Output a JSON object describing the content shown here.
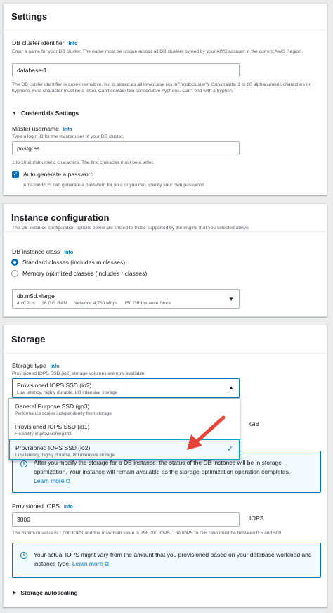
{
  "settings": {
    "title": "Settings",
    "cluster_identifier": {
      "label": "DB cluster identifier",
      "info": "Info",
      "description": "Enter a name for your DB cluster. The name must be unique across all DB clusters owned by your AWS account in the current AWS Region.",
      "value": "database-1",
      "constraints": "The DB cluster identifier is case-insensitive, but is stored as all lowercase (as in \"mydbcluster\"). Constraints: 1 to 60 alphanumeric characters or hyphens. First character must be a letter. Can't contain two consecutive hyphens. Can't end with a hyphen."
    },
    "credentials": {
      "title": "Credentials Settings",
      "master_username_label": "Master username",
      "info": "Info",
      "master_username_desc": "Type a login ID for the master user of your DB cluster.",
      "master_username_value": "postgres",
      "master_username_constraints": "1 to 16 alphanumeric characters. The first character must be a letter.",
      "auto_password_label": "Auto generate a password",
      "auto_password_checked": true,
      "auto_password_desc": "Amazon RDS can generate a password for you, or you can specify your own password."
    }
  },
  "instance_config": {
    "title": "Instance configuration",
    "description": "The DB instance configuration options below are limited to those supported by the engine that you selected above.",
    "class_label": "DB instance class",
    "info": "Info",
    "options": [
      {
        "label": "Standard classes (includes m classes)",
        "selected": true
      },
      {
        "label": "Memory optimized classes (includes r classes)",
        "selected": false
      }
    ],
    "selected_class": "db.m5d.xlarge",
    "selected_class_details": "4 vCPUs     16 GiB RAM     Network: 4,750 Mbps     150 GB Instance Store"
  },
  "storage": {
    "title": "Storage",
    "type_label": "Storage type",
    "info": "Info",
    "type_desc": "Provisioned IOPS SSD (io2) storage volumes are now available.",
    "selected_type": "Provisioned IOPS SSD (io2)",
    "selected_type_desc": "Low latency, highly durable, I/O intensive storage",
    "dropdown_options": [
      {
        "title": "General Purpose SSD (gp3)",
        "desc": "Performance scales independently from storage",
        "selected": false
      },
      {
        "title": "Provisioned IOPS SSD (io1)",
        "desc": "Flexibility in provisioning I/O",
        "selected": false
      },
      {
        "title": "Provisioned IOPS SSD (io2)",
        "desc": "Low latency, highly durable, I/O intensive storage",
        "selected": true
      }
    ],
    "gib_unit": "GiB",
    "alert1_text": "After you modify the storage for a DB instance, the status of the DB instance will be in storage-optimization. Your instance will remain available as the storage-optimization operation completes.",
    "learn_more": "Learn more",
    "iops_label": "Provisioned IOPS",
    "iops_value": "3000",
    "iops_unit": "IOPS",
    "iops_hint": "The minimum value is 1,000 IOPS and the maximum value is 256,000 IOPS. The IOPS to GiB ratio must be between 0.5 and 500",
    "alert2_text": "Your actual IOPS might vary from the amount that you provisioned based on your database workload and instance type.",
    "autoscaling_label": "Storage autoscaling"
  },
  "colors": {
    "accent": "#0073bb",
    "annotation_arrow": "#e8443a"
  },
  "icons": [
    "caret-down-icon",
    "caret-up-icon",
    "check-icon",
    "info-circle-icon",
    "external-link-icon",
    "arrow-annotation-icon"
  ]
}
